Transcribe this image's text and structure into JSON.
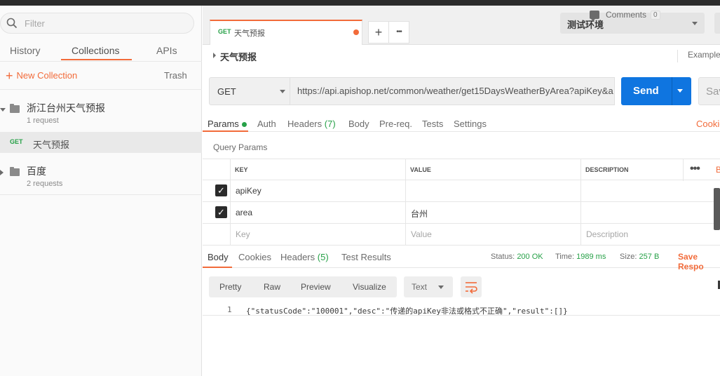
{
  "sidebar": {
    "filter_placeholder": "Filter",
    "tabs": [
      "History",
      "Collections",
      "APIs"
    ],
    "new_collection": "New Collection",
    "trash": "Trash",
    "collections": [
      {
        "name": "浙江台州天气预报",
        "count": "1 request",
        "expanded": true
      },
      {
        "name": "百度",
        "count": "2 requests",
        "expanded": false
      }
    ],
    "request": {
      "method": "GET",
      "name": "天气预报"
    }
  },
  "tabstrip": {
    "tab": {
      "method": "GET",
      "name": "天气预报"
    },
    "add": "+",
    "more": "•••",
    "environment": "测试环境"
  },
  "titlebar": {
    "title": "天气预报",
    "comments": "Comments",
    "comments_count": "0",
    "examples": "Example"
  },
  "request": {
    "method": "GET",
    "url": "https://api.apishop.net/common/weather/get15DaysWeatherByArea?apiKey&a",
    "send": "Send",
    "save": "Sav"
  },
  "req_tabs": {
    "params": "Params",
    "auth": "Auth",
    "headers": "Headers",
    "headers_count": "(7)",
    "body": "Body",
    "prereq": "Pre-req.",
    "tests": "Tests",
    "settings": "Settings",
    "cookies": "Cookie"
  },
  "query_params": {
    "title": "Query Params",
    "headers": [
      "KEY",
      "VALUE",
      "DESCRIPTION"
    ],
    "bulk": "B",
    "rows": [
      {
        "key": "apiKey",
        "value": "",
        "checked": true
      },
      {
        "key": "area",
        "value": "台州",
        "checked": true
      }
    ],
    "placeholders": {
      "key": "Key",
      "value": "Value",
      "description": "Description"
    }
  },
  "response": {
    "tabs": {
      "body": "Body",
      "cookies": "Cookies",
      "headers": "Headers",
      "headers_count": "(5)",
      "test_results": "Test Results"
    },
    "status_label": "Status:",
    "status": "200 OK",
    "time_label": "Time:",
    "time": "1989 ms",
    "size_label": "Size:",
    "size": "257 B",
    "save": "Save Respo",
    "views": [
      "Pretty",
      "Raw",
      "Preview",
      "Visualize"
    ],
    "format": "Text",
    "line_no": "1",
    "body": "{\"statusCode\":\"100001\",\"desc\":\"传递的apiKey非法或格式不正确\",\"result\":[]}"
  },
  "colors": {
    "accent": "#f26b3a",
    "send": "#0f75e0",
    "get": "#27a148"
  }
}
